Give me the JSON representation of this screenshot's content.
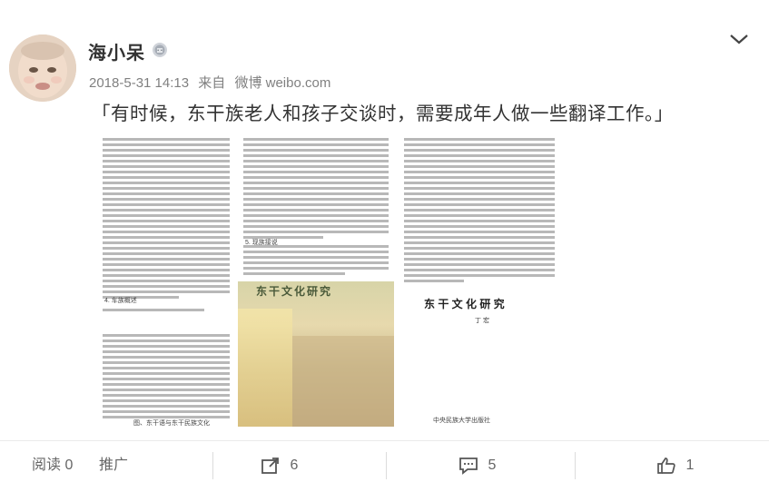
{
  "user": {
    "name": "海小呆",
    "badge_icon": "vip-badge-icon"
  },
  "meta": {
    "timestamp": "2018-5-31 14:13",
    "source_prefix": "来自",
    "source_name": "微博 weibo.com"
  },
  "post": {
    "text": "「有时候，东干族老人和孩子交谈时，需要成年人做一些翻译工作。」"
  },
  "images": {
    "book_title": "东 干 文 化 研 究",
    "book_author": "丁 宏",
    "publisher": "中央民族大学出版社",
    "figure_caption": "图、东干语与东干民族文化",
    "section_heading_1": "4. 车族概述",
    "section_heading_2": "5. 现族接说",
    "cover_title": "东干文化研究"
  },
  "actions": {
    "read_label": "阅读 0",
    "promote_label": "推广",
    "share_count": "6",
    "comment_count": "5",
    "like_count": "1"
  },
  "colors": {
    "text": "#333333",
    "meta": "#808080",
    "divider": "#eaeaea"
  }
}
